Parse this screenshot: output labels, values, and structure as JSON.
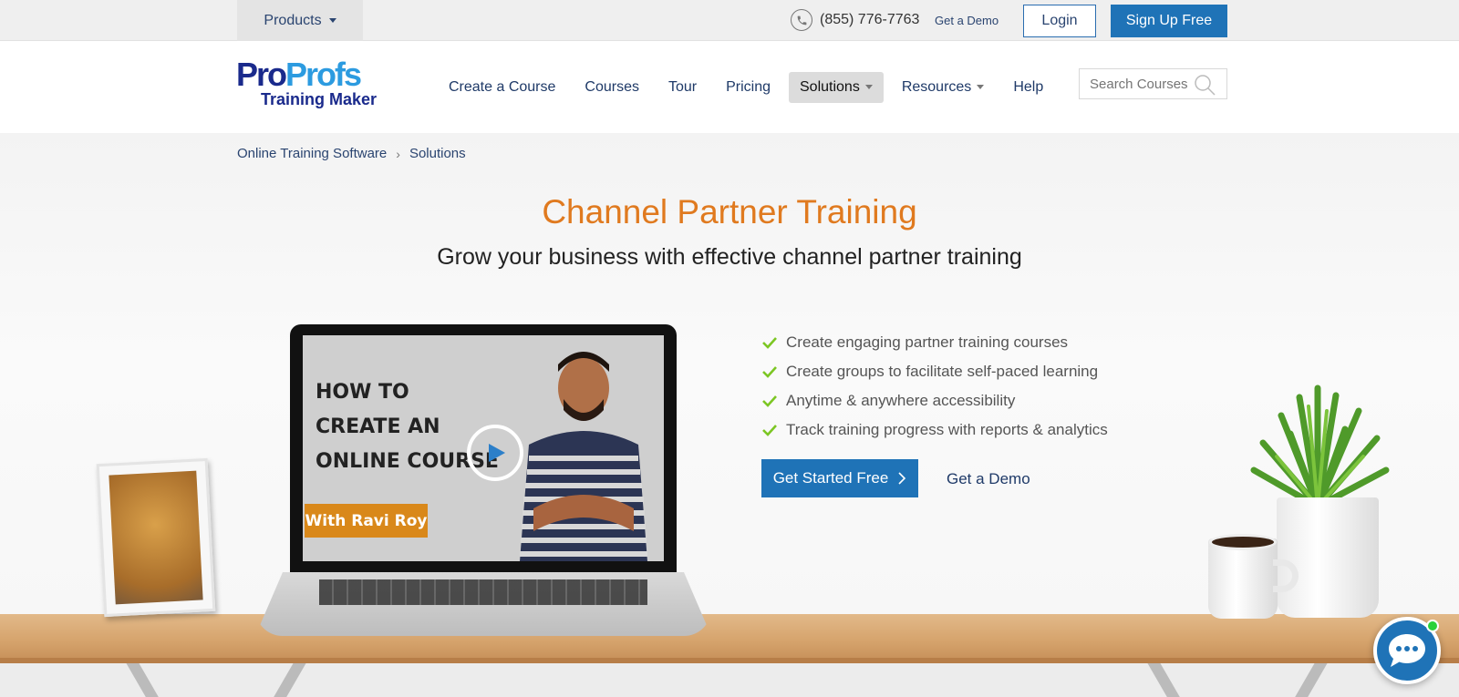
{
  "topbar": {
    "products_label": "Products",
    "phone": "(855) 776-7763",
    "demo_label": "Get a Demo",
    "login_label": "Login",
    "signup_label": "Sign Up Free"
  },
  "logo": {
    "pro1": "Pro",
    "pro2": "Profs",
    "sub": "Training Maker"
  },
  "nav": {
    "items": [
      {
        "label": "Create a Course"
      },
      {
        "label": "Courses"
      },
      {
        "label": "Tour"
      },
      {
        "label": "Pricing"
      },
      {
        "label": "Solutions",
        "active": true
      },
      {
        "label": "Resources"
      },
      {
        "label": "Help"
      }
    ],
    "search_placeholder": "Search Courses"
  },
  "breadcrumb": {
    "items": [
      "Online Training Software",
      "Solutions"
    ],
    "separator": "›"
  },
  "hero": {
    "title": "Channel Partner Training",
    "subtitle": "Grow your business with effective channel partner training",
    "features": [
      "Create engaging partner training courses",
      "Create groups to facilitate self-paced learning",
      "Anytime & anywhere accessibility",
      "Track training progress with reports & analytics"
    ],
    "cta_label": "Get Started Free",
    "demo_label": "Get a Demo"
  },
  "video": {
    "line1": "HOW TO",
    "line2": "CREATE AN",
    "line3": "ONLINE COURSE",
    "badge": "With Ravi Roy"
  },
  "colors": {
    "brand_blue": "#1f73b7",
    "title_orange": "#e07a1f",
    "check_green": "#7cc623",
    "chat_online": "#2ad13a"
  }
}
